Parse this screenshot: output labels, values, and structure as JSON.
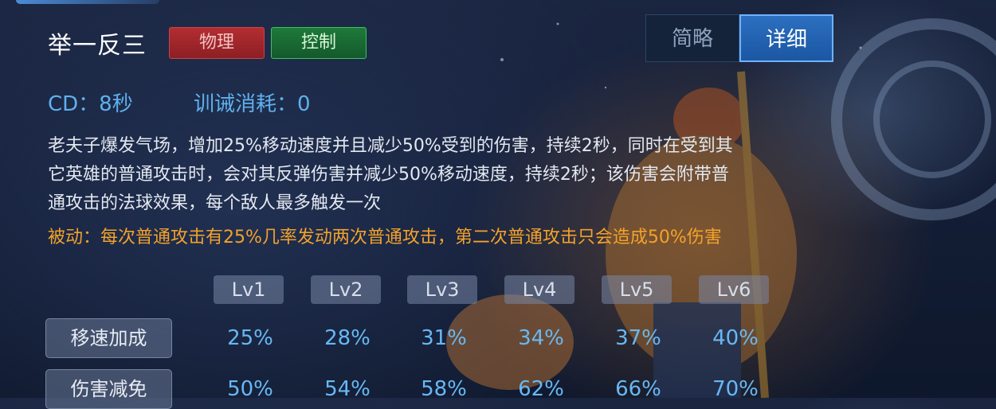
{
  "skill": {
    "name": "举一反三",
    "tags": [
      "物理",
      "控制"
    ],
    "cd": "CD：8秒",
    "cost": "训诫消耗：0",
    "description_lines": [
      "老夫子爆发气场，增加25%移动速度并且减少50%受到的伤害，持续2秒，同时在受到其",
      "它英雄的普通攻击时，会对其反弹伤害并减少50%移动速度，持续2秒；该伤害会附带普",
      "通攻击的法球效果，每个敌人最多触发一次"
    ],
    "passive": "被动：每次普通攻击有25%几率发动两次普通攻击，第二次普通攻击只会造成50%伤害"
  },
  "view_toggle": {
    "brief": "简略",
    "detail": "详细",
    "active": "详细"
  },
  "level_table": {
    "levels": [
      "Lv1",
      "Lv2",
      "Lv3",
      "Lv4",
      "Lv5",
      "Lv6"
    ],
    "rows": [
      {
        "label": "移速加成",
        "values": [
          "25%",
          "28%",
          "31%",
          "34%",
          "37%",
          "40%"
        ]
      },
      {
        "label": "伤害减免",
        "values": [
          "50%",
          "54%",
          "58%",
          "62%",
          "66%",
          "70%"
        ]
      }
    ]
  },
  "colors": {
    "physical_tag": "#b32d31",
    "control_tag": "#1e7a3a",
    "stat_text": "#5fb0ee",
    "passive_text": "#f3a22a",
    "active_toggle": "#2c6fc0"
  }
}
